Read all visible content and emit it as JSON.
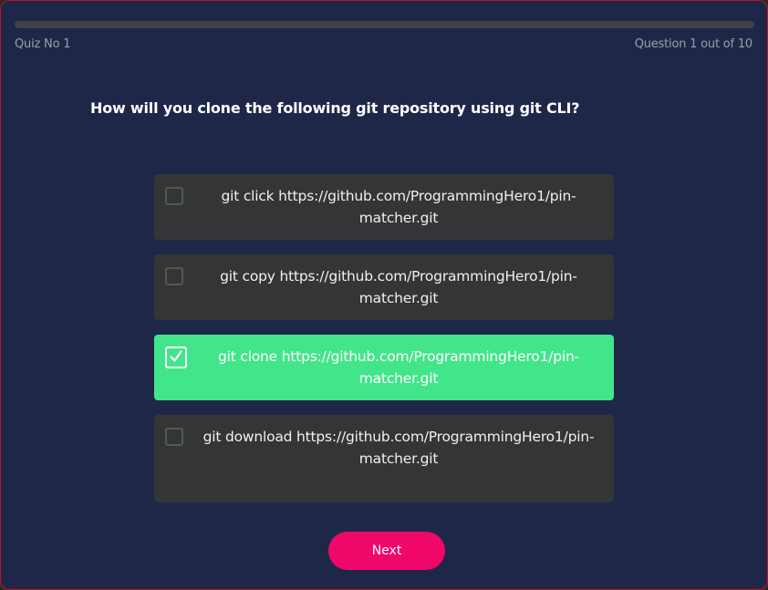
{
  "header": {
    "quiz_label": "Quiz No 1",
    "question_counter": "Question 1 out of 10",
    "progress_fraction": 0
  },
  "question": {
    "text": "How will you clone the following git repository using git CLI?"
  },
  "options": [
    {
      "label": "git click https://github.com/ProgrammingHero1/pin-matcher.git",
      "checked": false
    },
    {
      "label": "git copy https://github.com/ProgrammingHero1/pin-matcher.git",
      "checked": false
    },
    {
      "label": "git clone https://github.com/ProgrammingHero1/pin-matcher.git",
      "checked": true
    },
    {
      "label": "git download https://github.com/ProgrammingHero1/pin-matcher.git",
      "checked": false
    }
  ],
  "actions": {
    "next_label": "Next"
  },
  "colors": {
    "background": "#1f2749",
    "option_background": "#333537",
    "selected_option": "#43e58a",
    "next_button": "#f0076a"
  }
}
